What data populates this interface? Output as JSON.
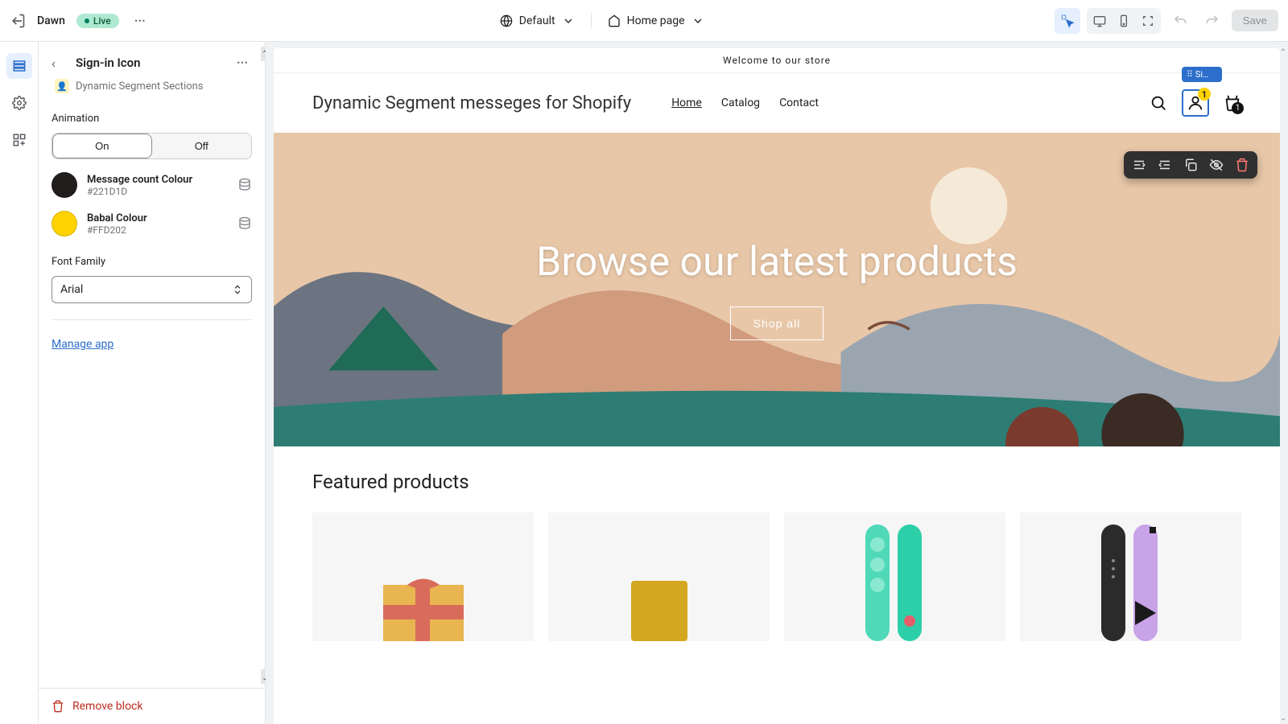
{
  "topbar": {
    "theme_name": "Dawn",
    "status_badge": "Live",
    "viewport_label": "Default",
    "page_label": "Home page",
    "save_label": "Save"
  },
  "sidebar": {
    "panel_title": "Sign-in Icon",
    "subtitle": "Dynamic Segment Sections",
    "animation": {
      "label": "Animation",
      "on": "On",
      "off": "Off"
    },
    "colors": [
      {
        "name": "Message count Colour",
        "hex": "#221D1D"
      },
      {
        "name": "Babal Colour",
        "hex": "#FFD202"
      }
    ],
    "font_family": {
      "label": "Font Family",
      "value": "Arial"
    },
    "manage_link": "Manage app",
    "remove_block": "Remove block"
  },
  "preview": {
    "announcement": "Welcome to our store",
    "site_title": "Dynamic Segment messeges for Shopify",
    "nav": {
      "home": "Home",
      "catalog": "Catalog",
      "contact": "Contact"
    },
    "selected_tag": "Si…",
    "account_badge": "1",
    "cart_badge": "1",
    "hero_title": "Browse our latest products",
    "hero_button": "Shop all",
    "featured_title": "Featured products"
  }
}
